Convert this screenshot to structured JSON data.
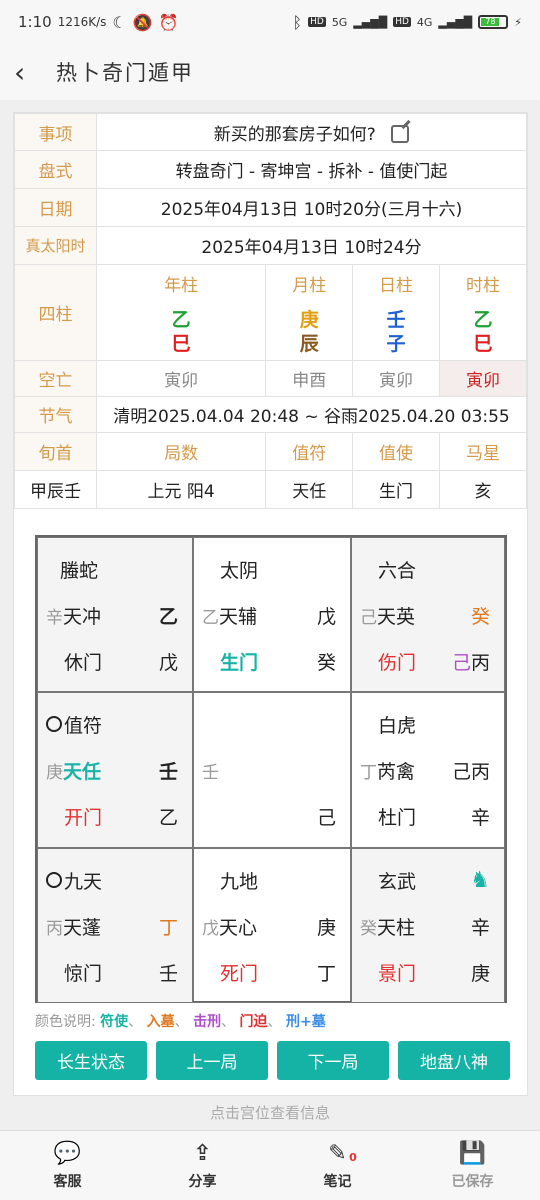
{
  "status_bar": {
    "time": "1:10",
    "net_speed": "1216K/s",
    "icons": [
      "moon-icon",
      "bell-off-icon",
      "alarm-icon",
      "bluetooth-icon",
      "signal-icon",
      "battery-icon"
    ],
    "sim1": "5G",
    "sim2": "4G",
    "battery": "78"
  },
  "header": {
    "back_glyph": "‹",
    "title": "热卜奇门遁甲"
  },
  "info": {
    "question_label": "事项",
    "question": "新买的那套房子如何?",
    "pan_label": "盘式",
    "pan": "转盘奇门 - 寄坤宫 - 拆补 - 值使门起",
    "date_label": "日期",
    "date": "2025年04月13日 10时20分(三月十六)",
    "solar_label": "真太阳时",
    "solar": "2025年04月13日 10时24分",
    "pillars_label": "四柱",
    "pillars": [
      {
        "head": "年柱",
        "gan": "乙",
        "zhi": "巳",
        "gan_color": "#22a035",
        "zhi_color": "#e02020"
      },
      {
        "head": "月柱",
        "gan": "庚",
        "zhi": "辰",
        "gan_color": "#e0a010",
        "zhi_color": "#8a5a20"
      },
      {
        "head": "日柱",
        "gan": "壬",
        "zhi": "子",
        "gan_color": "#2060d0",
        "zhi_color": "#2060d0"
      },
      {
        "head": "时柱",
        "gan": "乙",
        "zhi": "巳",
        "gan_color": "#22a035",
        "zhi_color": "#e02020"
      }
    ],
    "kongwang_label": "空亡",
    "kongwang": [
      "寅卯",
      "申酉",
      "寅卯",
      "寅卯"
    ],
    "jieqi_label": "节气",
    "jieqi": "清明2025.04.04 20:48 ~ 谷雨2025.04.20 03:55",
    "sub_heads": [
      "旬首",
      "局数",
      "值符",
      "值使",
      "马星"
    ],
    "sub_values": [
      "甲辰壬",
      "上元 阳4",
      "天任",
      "生门",
      "亥"
    ]
  },
  "palaces": [
    {
      "r1a": "螣蛇",
      "r2s": "辛",
      "r2a": "天冲",
      "r2e": "乙",
      "r3a": "休门",
      "r3e": "戊"
    },
    {
      "r1a": "太阴",
      "r2s": "乙",
      "r2a": "天辅",
      "r2e": "戊",
      "r3a": "生门",
      "r3e": "癸"
    },
    {
      "r1a": "六合",
      "r2s": "己",
      "r2a": "天英",
      "r2e": "癸",
      "r3a": "伤门",
      "r3s": "己",
      "r3e": "丙"
    },
    {
      "r1a": "值符",
      "r2s": "庚",
      "r2a": "天任",
      "r2e": "壬",
      "r3a": "开门",
      "r3e": "乙"
    },
    {
      "r2s": "壬",
      "r3e": "己"
    },
    {
      "r1a": "白虎",
      "r2s": "丁",
      "r2a": "芮禽",
      "r2e": "己丙",
      "r3a": "杜门",
      "r3e": "辛"
    },
    {
      "r1a": "九天",
      "r2s": "丙",
      "r2a": "天蓬",
      "r2e": "丁",
      "r3a": "惊门",
      "r3e": "壬"
    },
    {
      "r1a": "九地",
      "r2s": "戊",
      "r2a": "天心",
      "r2e": "庚",
      "r3a": "死门",
      "r3e": "丁"
    },
    {
      "r1a": "玄武",
      "r2s": "癸",
      "r2a": "天柱",
      "r2e": "辛",
      "r3a": "景门",
      "r3e": "庚"
    }
  ],
  "legend": {
    "prefix": "颜色说明:",
    "items": [
      "符使",
      "入墓",
      "击刑",
      "门迫",
      "刑+墓"
    ],
    "sep": "、"
  },
  "buttons": [
    "长生状态",
    "上一局",
    "下一局",
    "地盘八神"
  ],
  "hint": "点击宫位查看信息",
  "nav": [
    {
      "label": "客服",
      "icon": "chat-icon"
    },
    {
      "label": "分享",
      "icon": "share-icon"
    },
    {
      "label": "笔记",
      "icon": "note-icon",
      "badge": "0"
    },
    {
      "label": "已保存",
      "icon": "save-icon"
    }
  ]
}
